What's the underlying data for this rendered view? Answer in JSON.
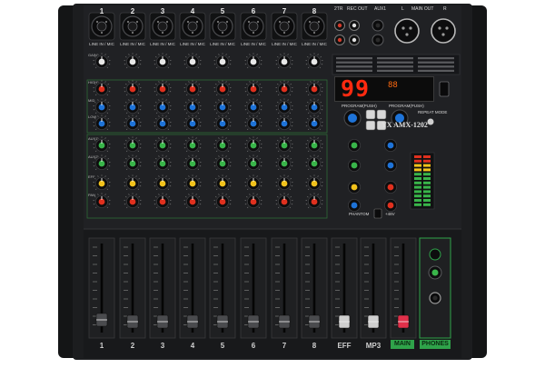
{
  "device": {
    "model": "YX AMX-1202",
    "display_value": "99",
    "display_small": "88"
  },
  "channels": {
    "numbers": [
      "1",
      "2",
      "3",
      "4",
      "5",
      "6",
      "7",
      "8"
    ],
    "input_label": "LINE IN / MIC",
    "knob_rows": [
      "GAIN",
      "HIGH",
      "MID",
      "LOW",
      "AUX1",
      "AUX2",
      "EFF",
      "PAN"
    ]
  },
  "top_right": {
    "labels": [
      "2TR",
      "REC OUT",
      "AUX1",
      "L",
      "MAIN OUT",
      "R"
    ]
  },
  "faders": {
    "labels": [
      "1",
      "2",
      "3",
      "4",
      "5",
      "6",
      "7",
      "8",
      "EFF",
      "MP3",
      "MAIN",
      "PHONES"
    ],
    "scale": [
      "10",
      "5",
      "0",
      "5",
      "10",
      "20",
      "30",
      "40",
      "60",
      "∞"
    ]
  },
  "controls": {
    "program": "PROGRAM(PUSH)",
    "repeat": "REPEAT MODE",
    "phantom": "PHANTOM",
    "plus48v": "+48V"
  },
  "colors": {
    "body": "#1b1c1e",
    "panel": "#232427",
    "accent_green": "#2fa34a",
    "knob_blue": "#1e73d8",
    "knob_green": "#39b54a",
    "knob_yellow": "#f2c21b",
    "knob_red": "#e0301e",
    "display_red": "#ff2a10"
  }
}
